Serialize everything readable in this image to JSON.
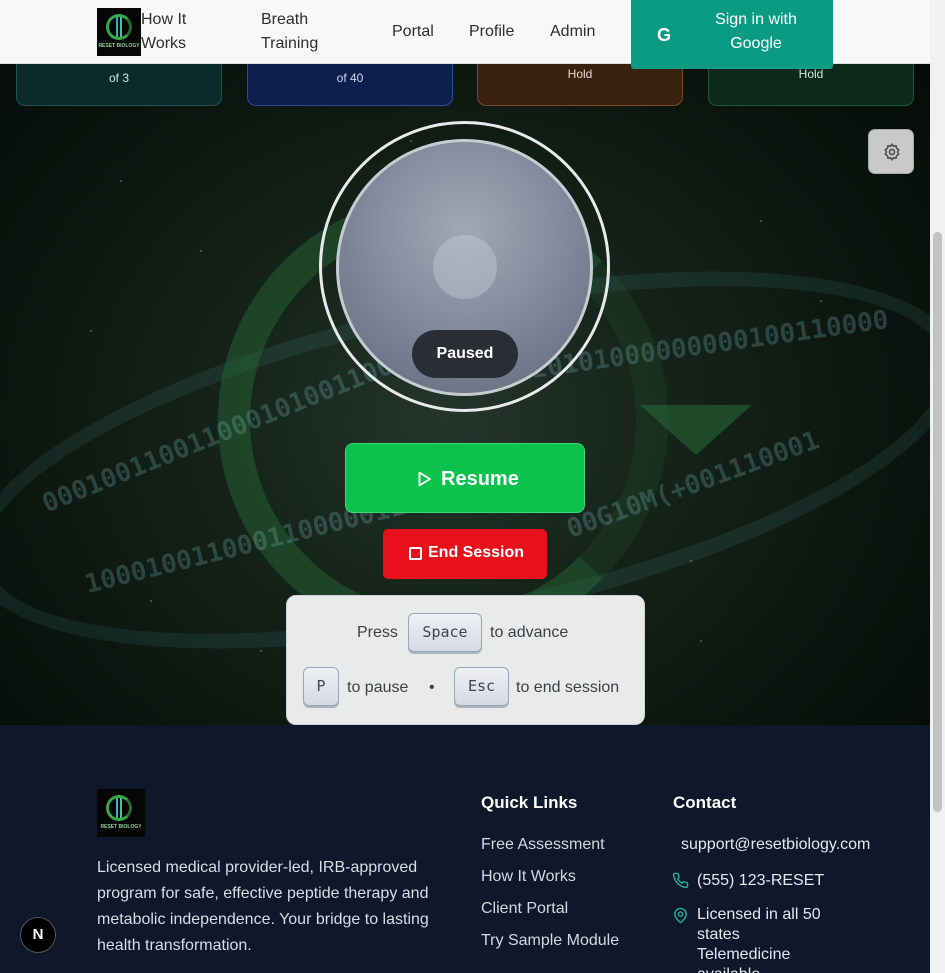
{
  "nav": {
    "links": [
      "How It Works",
      "Breath Training",
      "Portal",
      "Profile",
      "Admin"
    ],
    "signin_label": "Sign in with Google",
    "google_glyph": "G"
  },
  "stats": [
    {
      "text": "of 3"
    },
    {
      "text": "of 40"
    },
    {
      "text": "Hold"
    },
    {
      "text": "Hold"
    }
  ],
  "session": {
    "status": "Paused",
    "resume_label": "Resume",
    "end_label": "End Session"
  },
  "hints": {
    "press": "Press",
    "space_key": "Space",
    "to_advance": "to advance",
    "p_key": "P",
    "to_pause": "to pause",
    "separator": "•",
    "esc_key": "Esc",
    "to_end": "to end session"
  },
  "footer": {
    "description": "Licensed medical provider-led, IRB-approved program for safe, effective peptide therapy and metabolic independence. Your bridge to lasting health transformation.",
    "quick_links_title": "Quick Links",
    "quick_links": [
      "Free Assessment",
      "How It Works",
      "Client Portal",
      "Try Sample Module"
    ],
    "contact_title": "Contact",
    "email": "support@resetbiology.com",
    "phone": "(555) 123-RESET",
    "license_line1": "Licensed in all 50",
    "license_line2": "states",
    "license_line3": "Telemedicine",
    "license_line4": "available"
  },
  "badge": "N",
  "logo_text": "RESET BIOLOGY",
  "colors": {
    "accent": "#0a9b82",
    "resume": "#0bc24d",
    "end": "#e8101a",
    "footer_bg": "#0f172a"
  }
}
